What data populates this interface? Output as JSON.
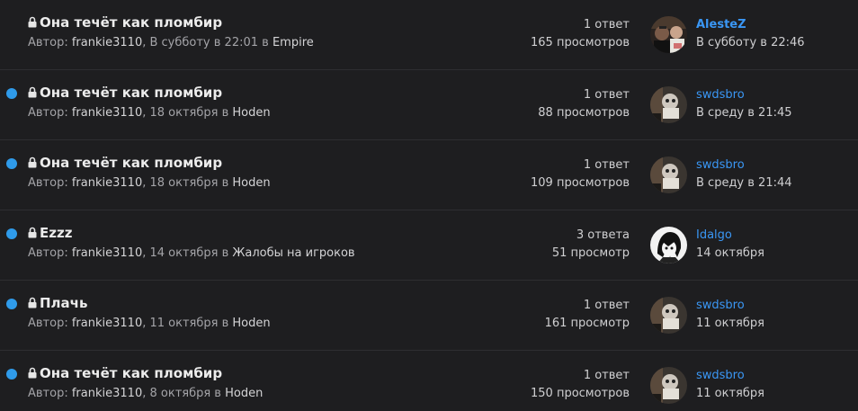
{
  "threads": [
    {
      "unread": false,
      "title": "Она течёт как пломбир",
      "meta_prefix": "Автор: ",
      "author": "frankie3110",
      "meta_middle": ", В субботу в 22:01 в ",
      "forum": "Empire",
      "replies": "1 ответ",
      "views": "165 просмотров",
      "last_user": "AlesteZ",
      "last_user_bold": true,
      "last_date": "В субботу в 22:46",
      "avatar_icon": "user-avatar-photo"
    },
    {
      "unread": true,
      "title": "Она течёт как пломбир",
      "meta_prefix": "Автор: ",
      "author": "frankie3110",
      "meta_middle": ", 18 октября в ",
      "forum": "Hoden",
      "replies": "1 ответ",
      "views": "88 просмотров",
      "last_user": "swdsbro",
      "last_user_bold": false,
      "last_date": "В среду в 21:45",
      "avatar_icon": "user-avatar-photo"
    },
    {
      "unread": true,
      "title": "Она течёт как пломбир",
      "meta_prefix": "Автор: ",
      "author": "frankie3110",
      "meta_middle": ", 18 октября в ",
      "forum": "Hoden",
      "replies": "1 ответ",
      "views": "109 просмотров",
      "last_user": "swdsbro",
      "last_user_bold": false,
      "last_date": "В среду в 21:44",
      "avatar_icon": "user-avatar-photo"
    },
    {
      "unread": true,
      "title": "Ezzz",
      "meta_prefix": "Автор: ",
      "author": "frankie3110",
      "meta_middle": ", 14 октября в ",
      "forum": "Жалобы на игроков",
      "replies": "3 ответа",
      "views": "51 просмотр",
      "last_user": "Idalgo",
      "last_user_bold": false,
      "last_date": "14 октября",
      "avatar_icon": "user-avatar-drawing"
    },
    {
      "unread": true,
      "title": "Плачь",
      "meta_prefix": "Автор: ",
      "author": "frankie3110",
      "meta_middle": ", 11 октября в ",
      "forum": "Hoden",
      "replies": "1 ответ",
      "views": "161 просмотр",
      "last_user": "swdsbro",
      "last_user_bold": false,
      "last_date": "11 октября",
      "avatar_icon": "user-avatar-photo"
    },
    {
      "unread": true,
      "title": "Она течёт как пломбир",
      "meta_prefix": "Автор: ",
      "author": "frankie3110",
      "meta_middle": ", 8 октября в ",
      "forum": "Hoden",
      "replies": "1 ответ",
      "views": "150 просмотров",
      "last_user": "swdsbro",
      "last_user_bold": false,
      "last_date": "11 октября",
      "avatar_icon": "user-avatar-photo"
    }
  ],
  "colors": {
    "background": "#1e1e20",
    "unread_dot": "#2f9bea",
    "link": "#3a97f5",
    "title": "#ececec"
  }
}
